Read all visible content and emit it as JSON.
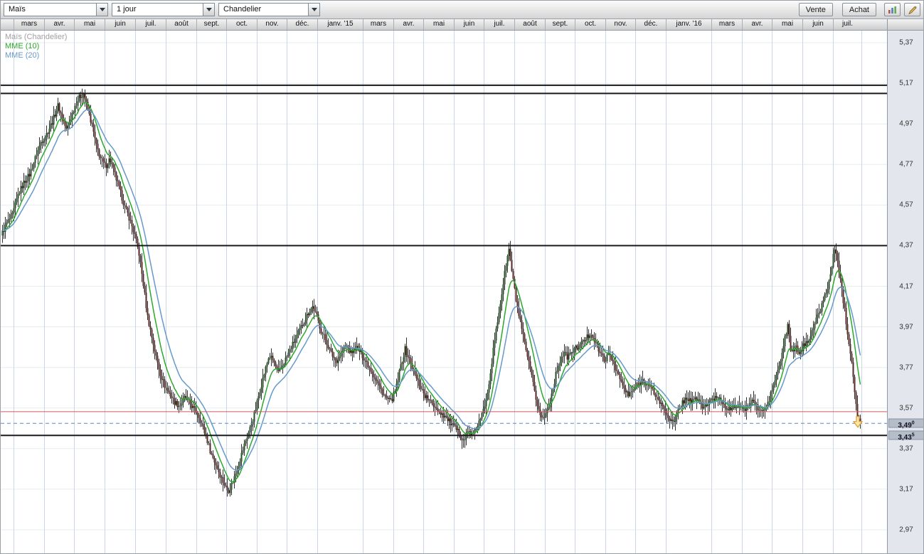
{
  "toolbar": {
    "instrument_select": {
      "value": "Maïs"
    },
    "timeframe_select": {
      "value": "1 jour"
    },
    "chart_type_select": {
      "value": "Chandelier"
    },
    "sell_label": "Vente",
    "buy_label": "Achat"
  },
  "legend": [
    {
      "label": "Maïs (Chandelier)",
      "color": "#a0a0a0"
    },
    {
      "label": "MME (10)",
      "color": "#2ca82c"
    },
    {
      "label": "MME (20)",
      "color": "#6699cc"
    }
  ],
  "time_axis": {
    "offset": 18,
    "months": [
      {
        "label": "mars",
        "w": 43
      },
      {
        "label": "avr.",
        "w": 42
      },
      {
        "label": "mai",
        "w": 43
      },
      {
        "label": "juin",
        "w": 43
      },
      {
        "label": "juil.",
        "w": 43
      },
      {
        "label": "août",
        "w": 43
      },
      {
        "label": "sept.",
        "w": 42
      },
      {
        "label": "oct.",
        "w": 43
      },
      {
        "label": "nov.",
        "w": 42
      },
      {
        "label": "déc.",
        "w": 43
      },
      {
        "label": "janv. '15",
        "w": 64
      },
      {
        "label": "mars",
        "w": 43
      },
      {
        "label": "avr.",
        "w": 42
      },
      {
        "label": "mai",
        "w": 43
      },
      {
        "label": "juin",
        "w": 42
      },
      {
        "label": "juil.",
        "w": 43
      },
      {
        "label": "août",
        "w": 43
      },
      {
        "label": "sept.",
        "w": 42
      },
      {
        "label": "oct.",
        "w": 43
      },
      {
        "label": "nov.",
        "w": 42
      },
      {
        "label": "déc.",
        "w": 43
      },
      {
        "label": "janv. '16",
        "w": 64
      },
      {
        "label": "mars",
        "w": 43
      },
      {
        "label": "avr.",
        "w": 42
      },
      {
        "label": "mai",
        "w": 43
      },
      {
        "label": "juin",
        "w": 43
      },
      {
        "label": "juil.",
        "w": 40
      }
    ]
  },
  "price_axis": {
    "ticks": [
      "5,37",
      "5,17",
      "4,97",
      "4,77",
      "4,57",
      "4,37",
      "4,17",
      "3,97",
      "3,77",
      "3,57",
      "3,37",
      "3,17",
      "2,97"
    ],
    "tick_values": [
      5.37,
      5.17,
      4.97,
      4.77,
      4.57,
      4.37,
      4.17,
      3.97,
      3.77,
      3.57,
      3.37,
      3.17,
      2.97
    ],
    "markers": [
      {
        "label": "3,49",
        "sup": "0",
        "value": 3.495
      },
      {
        "label": "3,43",
        "sup": "5",
        "value": 3.435
      }
    ]
  },
  "colors": {
    "h_grid": "#e7ebf1",
    "v_grid": "#ccd6e4"
  },
  "chart_data": {
    "type": "candlestick",
    "title": "Maïs (Chandelier)",
    "instrument": "Maïs",
    "timeframe": "1 jour",
    "y_axis": {
      "min": 2.97,
      "max": 5.37,
      "step": 0.2
    },
    "x_range": "mars 2014 - juil. 2016",
    "last_x": 1208,
    "bar_step": 2,
    "candle_colors": {
      "wick": "#303030",
      "up": "#274d27",
      "down": "#552727"
    },
    "overlays": [
      {
        "name": "MME (10)",
        "type": "ema",
        "period": 10,
        "color": "#2ca82c"
      },
      {
        "name": "MME (20)",
        "type": "ema",
        "period": 20,
        "color": "#6699cc"
      }
    ],
    "horizontal_lines": [
      {
        "name": "resistance-line-upper-1",
        "value": 5.16,
        "color": "#1a1a1a",
        "width": 2
      },
      {
        "name": "resistance-line-upper-2",
        "value": 5.12,
        "color": "#1a1a1a",
        "width": 2
      },
      {
        "name": "resistance-line-mid",
        "value": 4.37,
        "color": "#1a1a1a",
        "width": 2
      },
      {
        "name": "support-line",
        "value": 3.435,
        "color": "#1a1a1a",
        "width": 2
      },
      {
        "name": "alert-line",
        "value": 3.552,
        "color": "#cc5c5c",
        "width": 1
      },
      {
        "name": "last-price-line",
        "value": 3.495,
        "color": "#5b8ac2",
        "width": 1,
        "dash": "5 4"
      }
    ],
    "sell_marker": {
      "x": 1205,
      "price": 3.5,
      "fill": "#ffe9a8",
      "stroke": "#dd9a2e"
    },
    "price_path_anchors": [
      [
        0,
        4.42
      ],
      [
        8,
        4.48
      ],
      [
        16,
        4.52
      ],
      [
        24,
        4.62
      ],
      [
        32,
        4.68
      ],
      [
        40,
        4.72
      ],
      [
        48,
        4.8
      ],
      [
        56,
        4.88
      ],
      [
        64,
        4.92
      ],
      [
        72,
        4.98
      ],
      [
        80,
        5.06
      ],
      [
        86,
        5.0
      ],
      [
        92,
        4.94
      ],
      [
        98,
        5.0
      ],
      [
        104,
        5.06
      ],
      [
        110,
        5.1
      ],
      [
        116,
        5.12
      ],
      [
        122,
        5.04
      ],
      [
        128,
        4.96
      ],
      [
        134,
        4.86
      ],
      [
        140,
        4.8
      ],
      [
        147,
        4.76
      ],
      [
        153,
        4.8
      ],
      [
        160,
        4.72
      ],
      [
        167,
        4.64
      ],
      [
        174,
        4.56
      ],
      [
        181,
        4.5
      ],
      [
        188,
        4.42
      ],
      [
        194,
        4.33
      ],
      [
        200,
        4.18
      ],
      [
        206,
        4.02
      ],
      [
        212,
        3.92
      ],
      [
        218,
        3.82
      ],
      [
        224,
        3.74
      ],
      [
        230,
        3.68
      ],
      [
        237,
        3.64
      ],
      [
        244,
        3.6
      ],
      [
        251,
        3.58
      ],
      [
        258,
        3.62
      ],
      [
        264,
        3.6
      ],
      [
        270,
        3.57
      ],
      [
        277,
        3.54
      ],
      [
        283,
        3.48
      ],
      [
        289,
        3.42
      ],
      [
        295,
        3.35
      ],
      [
        301,
        3.3
      ],
      [
        307,
        3.25
      ],
      [
        313,
        3.2
      ],
      [
        319,
        3.16
      ],
      [
        325,
        3.2
      ],
      [
        331,
        3.26
      ],
      [
        337,
        3.33
      ],
      [
        343,
        3.4
      ],
      [
        350,
        3.47
      ],
      [
        357,
        3.55
      ],
      [
        364,
        3.66
      ],
      [
        370,
        3.74
      ],
      [
        377,
        3.83
      ],
      [
        383,
        3.8
      ],
      [
        390,
        3.74
      ],
      [
        397,
        3.79
      ],
      [
        404,
        3.84
      ],
      [
        411,
        3.89
      ],
      [
        418,
        3.94
      ],
      [
        425,
        3.99
      ],
      [
        432,
        4.04
      ],
      [
        438,
        4.07
      ],
      [
        444,
        4.02
      ],
      [
        450,
        3.95
      ],
      [
        457,
        3.9
      ],
      [
        464,
        3.84
      ],
      [
        471,
        3.8
      ],
      [
        478,
        3.84
      ],
      [
        485,
        3.88
      ],
      [
        492,
        3.84
      ],
      [
        499,
        3.87
      ],
      [
        506,
        3.84
      ],
      [
        513,
        3.8
      ],
      [
        520,
        3.76
      ],
      [
        527,
        3.71
      ],
      [
        534,
        3.66
      ],
      [
        541,
        3.62
      ],
      [
        548,
        3.6
      ],
      [
        555,
        3.66
      ],
      [
        562,
        3.78
      ],
      [
        568,
        3.86
      ],
      [
        575,
        3.8
      ],
      [
        582,
        3.73
      ],
      [
        589,
        3.68
      ],
      [
        596,
        3.63
      ],
      [
        603,
        3.6
      ],
      [
        610,
        3.58
      ],
      [
        617,
        3.55
      ],
      [
        624,
        3.53
      ],
      [
        631,
        3.5
      ],
      [
        638,
        3.47
      ],
      [
        645,
        3.44
      ],
      [
        651,
        3.41
      ],
      [
        657,
        3.46
      ],
      [
        663,
        3.43
      ],
      [
        669,
        3.48
      ],
      [
        675,
        3.52
      ],
      [
        681,
        3.6
      ],
      [
        687,
        3.72
      ],
      [
        693,
        3.88
      ],
      [
        699,
        4.02
      ],
      [
        705,
        4.16
      ],
      [
        710,
        4.28
      ],
      [
        714,
        4.35
      ],
      [
        719,
        4.22
      ],
      [
        725,
        4.08
      ],
      [
        731,
        3.97
      ],
      [
        737,
        3.87
      ],
      [
        743,
        3.77
      ],
      [
        749,
        3.67
      ],
      [
        755,
        3.57
      ],
      [
        761,
        3.51
      ],
      [
        767,
        3.55
      ],
      [
        773,
        3.62
      ],
      [
        779,
        3.72
      ],
      [
        785,
        3.8
      ],
      [
        791,
        3.84
      ],
      [
        797,
        3.82
      ],
      [
        803,
        3.85
      ],
      [
        810,
        3.87
      ],
      [
        817,
        3.89
      ],
      [
        824,
        3.92
      ],
      [
        830,
        3.94
      ],
      [
        836,
        3.89
      ],
      [
        842,
        3.84
      ],
      [
        848,
        3.81
      ],
      [
        855,
        3.83
      ],
      [
        862,
        3.79
      ],
      [
        868,
        3.73
      ],
      [
        875,
        3.67
      ],
      [
        882,
        3.63
      ],
      [
        889,
        3.66
      ],
      [
        896,
        3.69
      ],
      [
        903,
        3.71
      ],
      [
        910,
        3.68
      ],
      [
        917,
        3.65
      ],
      [
        924,
        3.61
      ],
      [
        931,
        3.57
      ],
      [
        938,
        3.53
      ],
      [
        945,
        3.49
      ],
      [
        951,
        3.55
      ],
      [
        958,
        3.6
      ],
      [
        965,
        3.62
      ],
      [
        972,
        3.6
      ],
      [
        979,
        3.62
      ],
      [
        986,
        3.57
      ],
      [
        993,
        3.59
      ],
      [
        1000,
        3.61
      ],
      [
        1007,
        3.63
      ],
      [
        1014,
        3.6
      ],
      [
        1021,
        3.57
      ],
      [
        1028,
        3.56
      ],
      [
        1035,
        3.59
      ],
      [
        1042,
        3.56
      ],
      [
        1049,
        3.57
      ],
      [
        1056,
        3.61
      ],
      [
        1063,
        3.57
      ],
      [
        1070,
        3.55
      ],
      [
        1077,
        3.58
      ],
      [
        1084,
        3.66
      ],
      [
        1090,
        3.73
      ],
      [
        1096,
        3.8
      ],
      [
        1101,
        3.9
      ],
      [
        1106,
        3.97
      ],
      [
        1111,
        3.84
      ],
      [
        1117,
        3.87
      ],
      [
        1123,
        3.84
      ],
      [
        1129,
        3.88
      ],
      [
        1135,
        3.91
      ],
      [
        1141,
        3.96
      ],
      [
        1147,
        4.01
      ],
      [
        1153,
        4.07
      ],
      [
        1159,
        4.13
      ],
      [
        1165,
        4.2
      ],
      [
        1167,
        4.26
      ],
      [
        1172,
        4.35
      ],
      [
        1176,
        4.3
      ],
      [
        1181,
        4.18
      ],
      [
        1186,
        4.05
      ],
      [
        1191,
        3.92
      ],
      [
        1196,
        3.8
      ],
      [
        1201,
        3.62
      ],
      [
        1205,
        3.52
      ],
      [
        1208,
        3.5
      ]
    ]
  }
}
